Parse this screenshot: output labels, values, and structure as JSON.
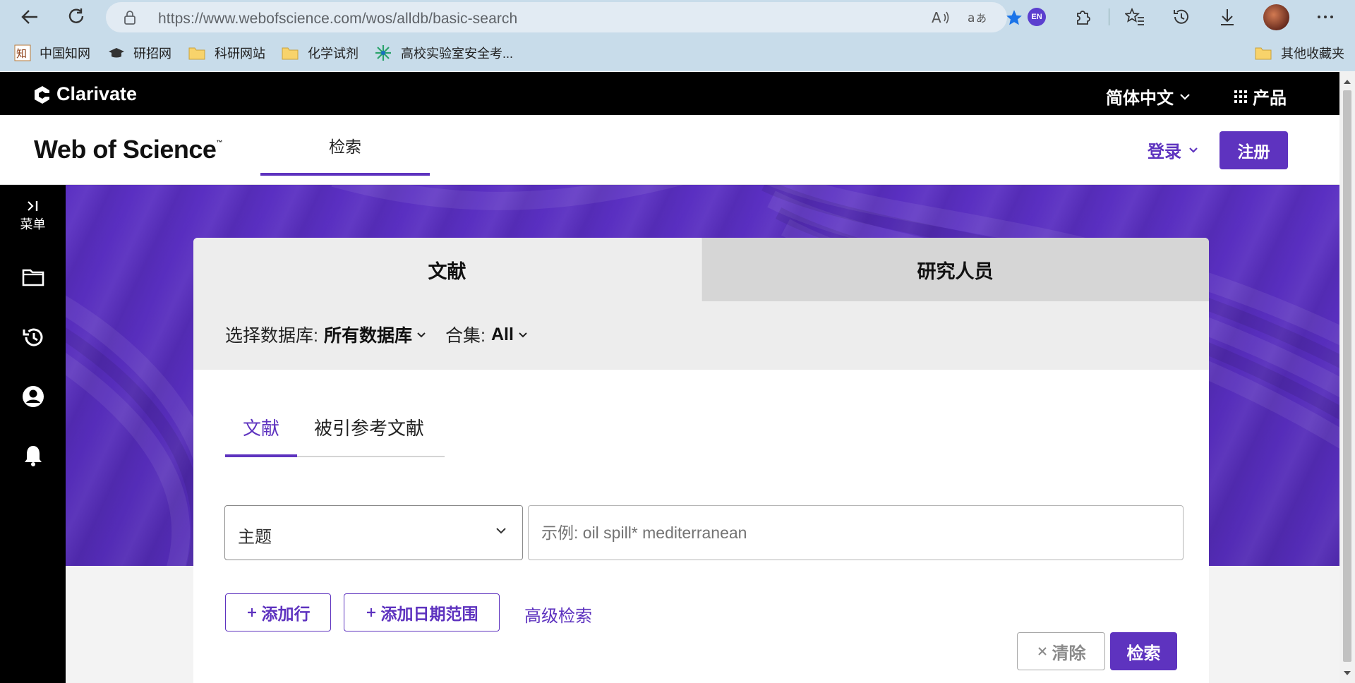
{
  "browser": {
    "url": "https://www.webofscience.com/wos/alldb/basic-search",
    "profile_badge": "EN",
    "bookmarks": [
      {
        "label": "中国知网",
        "icon": "cnki-icon"
      },
      {
        "label": "研招网",
        "icon": "graduation-cap-icon"
      },
      {
        "label": "科研网站",
        "icon": "folder-icon"
      },
      {
        "label": "化学试剂",
        "icon": "folder-icon"
      },
      {
        "label": "高校实验室安全考...",
        "icon": "lab-icon"
      }
    ],
    "other_bookmarks": "其他收藏夹"
  },
  "clarivate": {
    "brand": "Clarivate",
    "language": "简体中文",
    "products": "产品"
  },
  "header": {
    "logo": "Web of Science",
    "logo_tm": "™",
    "nav_tab": "检索",
    "login": "登录",
    "register": "注册"
  },
  "sidebar": {
    "menu_label": "菜单",
    "items": [
      "folder-icon",
      "history-icon",
      "account-icon",
      "bell-icon"
    ]
  },
  "search": {
    "tabs": [
      "文献",
      "研究人员"
    ],
    "db_label": "选择数据库:",
    "db_value": "所有数据库",
    "collection_label": "合集:",
    "collection_value": "All",
    "subtabs": [
      "文献",
      "被引参考文献"
    ],
    "field_value": "主题",
    "query_placeholder": "示例: oil spill* mediterranean",
    "add_row": "添加行",
    "add_date_range": "添加日期范围",
    "advanced": "高级检索",
    "clear": "清除",
    "submit": "检索"
  },
  "colors": {
    "accent": "#5e33bf",
    "hero": "#5a2fc2",
    "black_bar": "#000000",
    "chrome": "#c8dcea"
  }
}
